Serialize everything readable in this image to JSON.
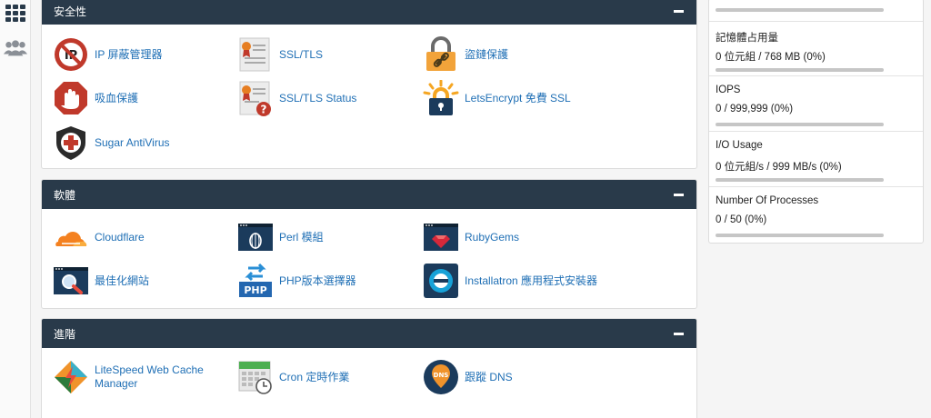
{
  "sidebar": {
    "apps_icon": "grid-icon",
    "users_icon": "users-icon"
  },
  "panels": [
    {
      "title": "安全性",
      "items": [
        {
          "label": "IP 屏蔽管理器",
          "icon": "ip-blocker-icon"
        },
        {
          "label": "SSL/TLS",
          "icon": "ssl-certificate-icon"
        },
        {
          "label": "盜鏈保護",
          "icon": "padlock-link-icon"
        },
        {
          "label": "吸血保護",
          "icon": "stop-hand-icon"
        },
        {
          "label": "SSL/TLS Status",
          "icon": "ssl-status-icon"
        },
        {
          "label": "LetsEncrypt 免費 SSL",
          "icon": "letsencrypt-lock-icon"
        },
        {
          "label": "Sugar AntiVirus",
          "icon": "antivirus-shield-icon"
        }
      ]
    },
    {
      "title": "軟體",
      "items": [
        {
          "label": "Cloudflare",
          "icon": "cloudflare-icon"
        },
        {
          "label": "Perl 模組",
          "icon": "perl-onion-icon"
        },
        {
          "label": "RubyGems",
          "icon": "rubygems-icon"
        },
        {
          "label": "最佳化網站",
          "icon": "optimize-website-icon"
        },
        {
          "label": "PHP版本選擇器",
          "icon": "php-selector-icon"
        },
        {
          "label": "Installatron 應用程式安裝器",
          "icon": "installatron-icon"
        }
      ]
    },
    {
      "title": "進階",
      "items": [
        {
          "label": "LiteSpeed Web Cache Manager",
          "icon": "litespeed-icon"
        },
        {
          "label": "Cron 定時作業",
          "icon": "cron-calendar-icon"
        },
        {
          "label": "跟蹤 DNS",
          "icon": "dns-pin-icon"
        }
      ]
    }
  ],
  "stats": [
    {
      "title": "記憶體占用量",
      "value": "0 位元組 / 768 MB   (0%)",
      "percent": 0
    },
    {
      "title": "IOPS",
      "value": "0 / 999,999   (0%)",
      "percent": 0
    },
    {
      "title": "I/O Usage",
      "value": "0 位元組/s / 999 MB/s   (0%)",
      "percent": 0
    },
    {
      "title": "Number Of Processes",
      "value": "0 / 50   (0%)",
      "percent": 0
    }
  ],
  "colors": {
    "panel_header": "#293a4a",
    "link": "#1f6fb5",
    "bar_track": "#c6c6c6"
  }
}
